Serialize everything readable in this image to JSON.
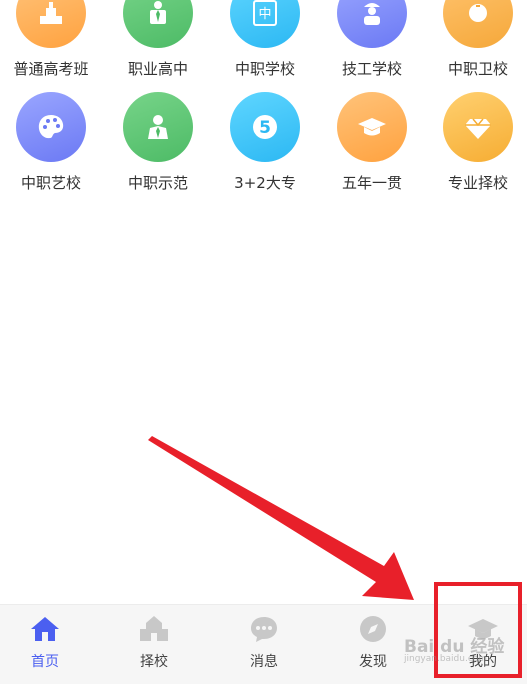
{
  "grid": {
    "row1": [
      {
        "label": "普通高考班",
        "color": "orange",
        "icon": "podium-icon"
      },
      {
        "label": "职业高中",
        "color": "green",
        "icon": "businessman-icon"
      },
      {
        "label": "中职学校",
        "color": "cyan",
        "icon": "book-icon"
      },
      {
        "label": "技工学校",
        "color": "blue",
        "icon": "worker-icon"
      },
      {
        "label": "中职卫校",
        "color": "pink",
        "icon": "nurse-icon"
      }
    ],
    "row2": [
      {
        "label": "中职艺校",
        "color": "blue",
        "icon": "palette-icon"
      },
      {
        "label": "中职示范",
        "color": "green",
        "icon": "person-suit-icon"
      },
      {
        "label": "3+2大专",
        "color": "cyan",
        "icon": "number-five-icon",
        "glyph": "5"
      },
      {
        "label": "五年一贯",
        "color": "orange",
        "icon": "graduation-cap-icon"
      },
      {
        "label": "专业择校",
        "color": "gold",
        "icon": "diamond-icon"
      }
    ],
    "book_glyph": "中"
  },
  "tabbar": {
    "tabs": [
      {
        "label": "首页",
        "icon": "home-icon",
        "active": true
      },
      {
        "label": "择校",
        "icon": "school-building-icon",
        "active": false
      },
      {
        "label": "消息",
        "icon": "chat-bubble-icon",
        "active": false
      },
      {
        "label": "发现",
        "icon": "compass-icon",
        "active": false
      },
      {
        "label": "我的",
        "icon": "graduation-cap-icon",
        "active": false
      }
    ]
  },
  "watermark": {
    "text": "Bai du 经验",
    "sub": "jingyan.baidu.com"
  },
  "colors": {
    "accent": "#4b5ff0",
    "annotation": "#e8202a"
  }
}
